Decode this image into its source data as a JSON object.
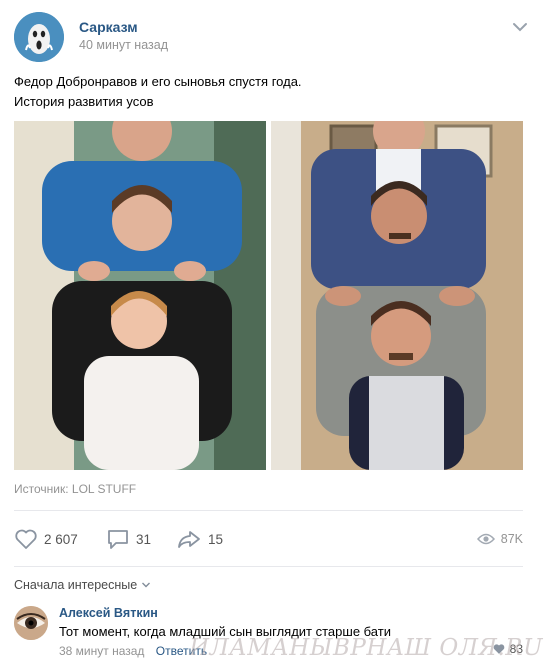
{
  "post": {
    "group_name": "Сарказм",
    "time": "40 минут назад",
    "text_line1": "Федор Добронравов и его сыновья спустя года.",
    "text_line2": "История развития усов",
    "source": "Источник: LOL STUFF",
    "photos": [
      {
        "icon": "photo-then"
      },
      {
        "icon": "photo-now"
      }
    ]
  },
  "actions": {
    "likes": "2 607",
    "comments": "31",
    "shares": "15",
    "views": "87K"
  },
  "comments_section": {
    "sort_label": "Сначала интересные",
    "items": [
      {
        "author": "Алексей Вяткин",
        "text": "Тот момент, когда младший сын выглядит старше бати",
        "time": "38 минут назад",
        "reply_label": "Ответить",
        "likes": "83"
      }
    ]
  },
  "watermark": "ИЛАМАНЫВРНАШ ОЛЯ.RU",
  "colors": {
    "link": "#2a5885",
    "muted": "#939393",
    "divider": "#e7e8ec"
  }
}
